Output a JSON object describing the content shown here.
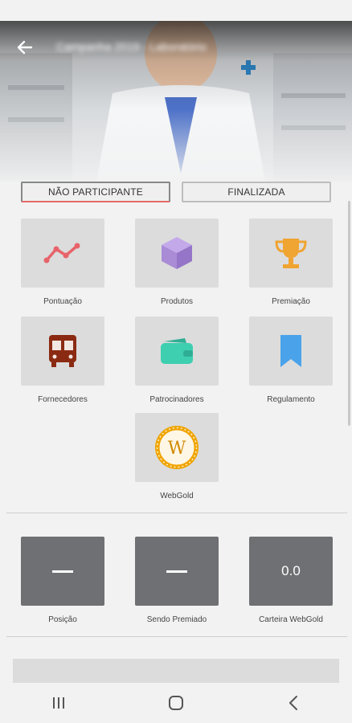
{
  "header": {
    "title": "Campanha 2019 - Laboratório"
  },
  "status": {
    "participation": "NÃO PARTICIPANTE",
    "state": "FINALIZADA"
  },
  "menu": {
    "items": [
      {
        "label": "Pontuação",
        "icon": "line-chart-icon",
        "color": "#e8636a"
      },
      {
        "label": "Produtos",
        "icon": "box-icon",
        "color": "#a98bd6"
      },
      {
        "label": "Premiação",
        "icon": "trophy-icon",
        "color": "#f0a432"
      },
      {
        "label": "Fornecedores",
        "icon": "bus-icon",
        "color": "#8b2a12"
      },
      {
        "label": "Patrocinadores",
        "icon": "wallet-icon",
        "color": "#3ecfb0"
      },
      {
        "label": "Regulamento",
        "icon": "bookmark-icon",
        "color": "#4aa3ea"
      },
      {
        "label": "WebGold",
        "icon": "webgold-coin-icon",
        "color": "#f0a400"
      }
    ]
  },
  "stats": {
    "position_label": "Posição",
    "awarded_label": "Sendo Premiado",
    "wallet_label": "Carteira WebGold",
    "wallet_value": "0.0"
  },
  "nav": {
    "recents": "recents-icon",
    "home": "home-icon",
    "back": "back-icon"
  }
}
